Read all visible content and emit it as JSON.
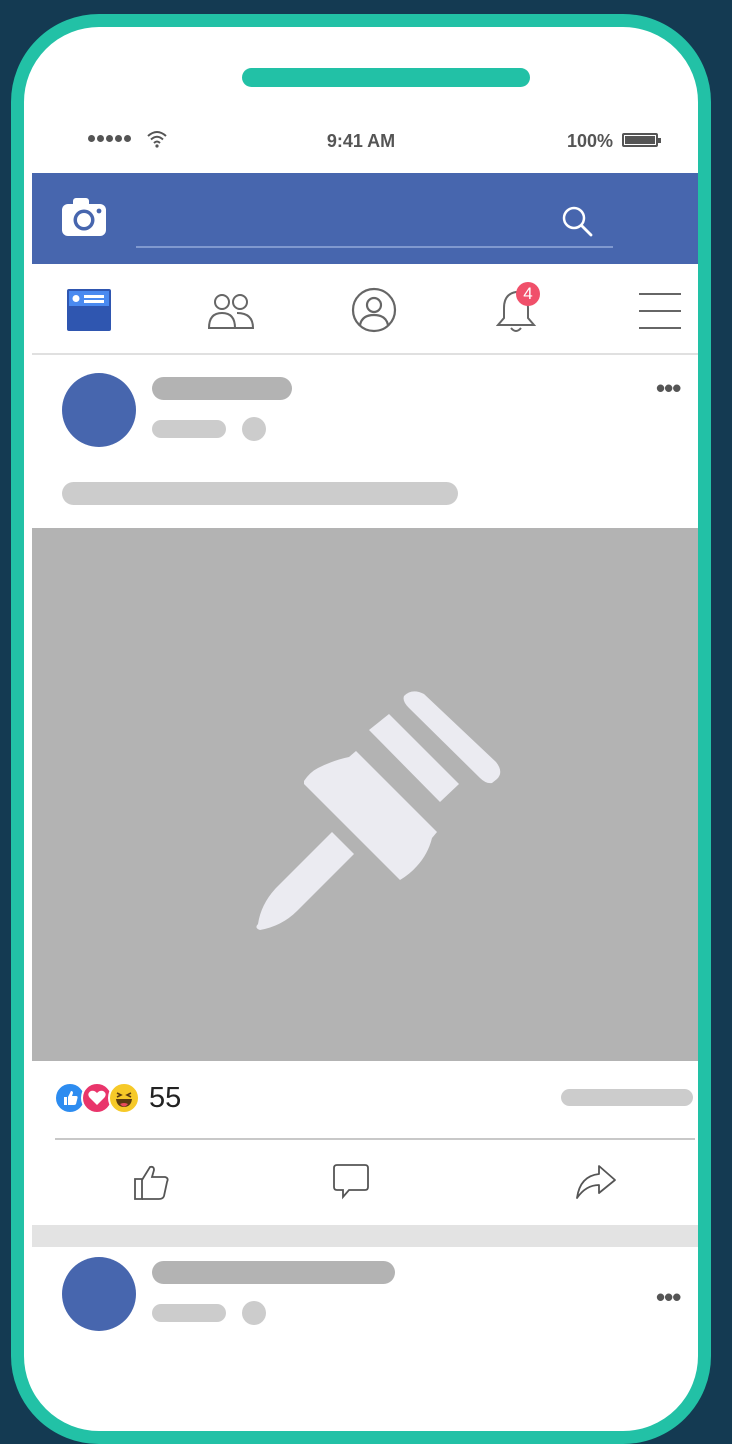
{
  "status": {
    "time": "9:41 AM",
    "battery": "100%"
  },
  "navbar": {
    "items": [
      {
        "name": "news-feed",
        "active": true
      },
      {
        "name": "friends"
      },
      {
        "name": "profile"
      },
      {
        "name": "notifications",
        "badge": "4"
      },
      {
        "name": "menu"
      }
    ]
  },
  "post": {
    "reaction_count": "55",
    "reactions": [
      "like",
      "love",
      "haha"
    ]
  },
  "colors": {
    "brand_blue": "#4766ae",
    "phone_frame": "#22c1a6",
    "background": "#143a52",
    "badge": "#f0506a"
  }
}
